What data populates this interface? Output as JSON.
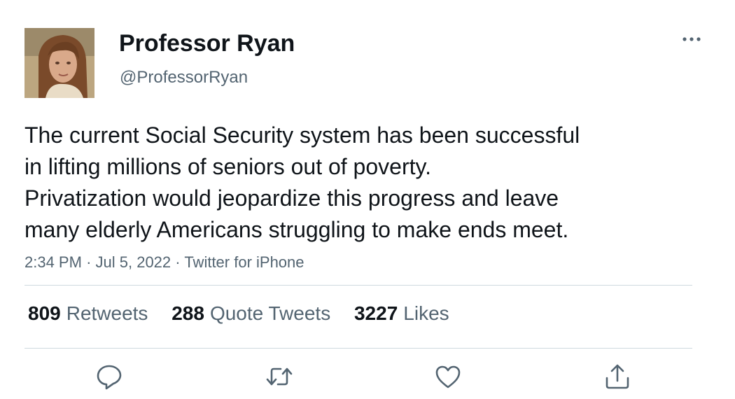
{
  "tweet": {
    "author": {
      "display_name": "Professor Ryan",
      "handle": "@ProfessorRyan",
      "avatar": "avatar-photo"
    },
    "text_lines": [
      "The current Social Security system has been successful",
      "in lifting millions of seniors out of poverty.",
      "Privatization would jeopardize this progress and leave",
      "many elderly Americans struggling to make ends meet."
    ],
    "time": "2:34 PM",
    "date": "Jul 5, 2022",
    "source": "Twitter for iPhone",
    "separator": "·",
    "stats": {
      "retweets": {
        "count": "809",
        "label": "Retweets"
      },
      "quotes": {
        "count": "288",
        "label": "Quote Tweets"
      },
      "likes": {
        "count": "3227",
        "label": "Likes"
      }
    },
    "icons": {
      "more": "more-horizontal-icon",
      "reply": "reply-icon",
      "retweet": "retweet-icon",
      "like": "heart-icon",
      "share": "share-icon"
    }
  },
  "colors": {
    "primary_text": "#0f1419",
    "secondary_text": "#536471",
    "divider": "#cfd9de"
  }
}
